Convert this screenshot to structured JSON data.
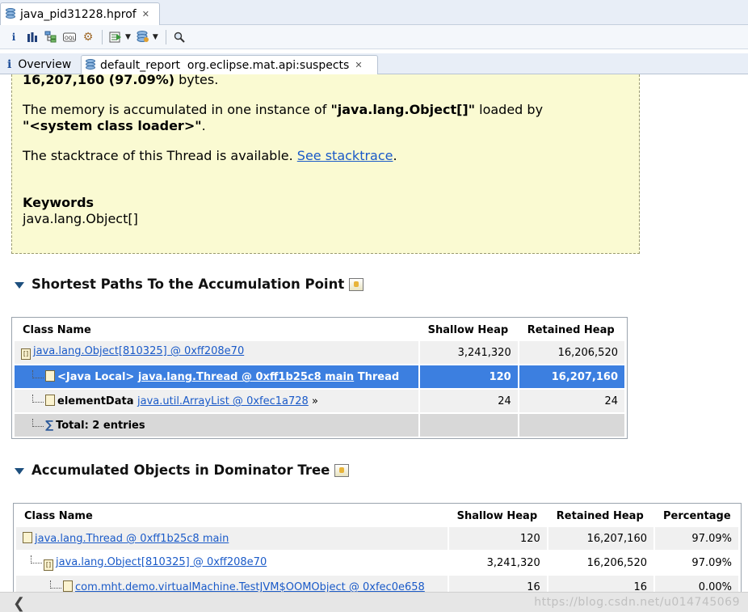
{
  "editor_tab": {
    "title": "java_pid31228.hprof"
  },
  "view_tabs": [
    {
      "label": "Overview"
    },
    {
      "label": "default_report  org.eclipse.mat.api:suspects"
    }
  ],
  "report": {
    "line1_value": "16,207,160 (97.09%)",
    "line1_suffix": " bytes.",
    "accum_prefix": "The memory is accumulated in one instance of ",
    "accum_class": "\"java.lang.Object[]\"",
    "accum_mid": " loaded by",
    "accum_loader": "\"<system class loader>\"",
    "accum_end": ".",
    "stack_text": "The stacktrace of this Thread is available. ",
    "stack_link": "See stacktrace",
    "stack_end": ".",
    "keywords_label": "Keywords",
    "keywords_value": "java.lang.Object[]"
  },
  "shortest_paths": {
    "title": "Shortest Paths To the Accumulation Point",
    "headers": [
      "Class Name",
      "Shallow Heap",
      "Retained Heap"
    ],
    "rows": [
      {
        "prefix": "",
        "link": "java.lang.Object[810325] @ 0xff208e70",
        "suffix": "",
        "shallow": "3,241,320",
        "retained": "16,206,520"
      },
      {
        "prefix": "<Java Local> ",
        "link": "java.lang.Thread @ 0xff1b25c8 main",
        "suffix": " Thread",
        "shallow": "120",
        "retained": "16,207,160"
      },
      {
        "prefix": "elementData ",
        "link": "java.util.ArrayList @ 0xfec1a728",
        "suffix": " »",
        "shallow": "24",
        "retained": "24"
      }
    ],
    "total": "Total: 2 entries"
  },
  "dominator": {
    "title": "Accumulated Objects in Dominator Tree",
    "headers": [
      "Class Name",
      "Shallow Heap",
      "Retained Heap",
      "Percentage"
    ],
    "rows": [
      {
        "link": "java.lang.Thread @ 0xff1b25c8 main",
        "shallow": "120",
        "retained": "16,207,160",
        "pct": "97.09%"
      },
      {
        "link": "java.lang.Object[810325] @ 0xff208e70",
        "shallow": "3,241,320",
        "retained": "16,206,520",
        "pct": "97.09%"
      },
      {
        "link": "com.mht.demo.virtualMachine.TestJVM$OOMObject @ 0xfec0e658",
        "shallow": "16",
        "retained": "16",
        "pct": "0.00%"
      }
    ]
  },
  "watermark": "https://blog.csdn.net/u014745069"
}
